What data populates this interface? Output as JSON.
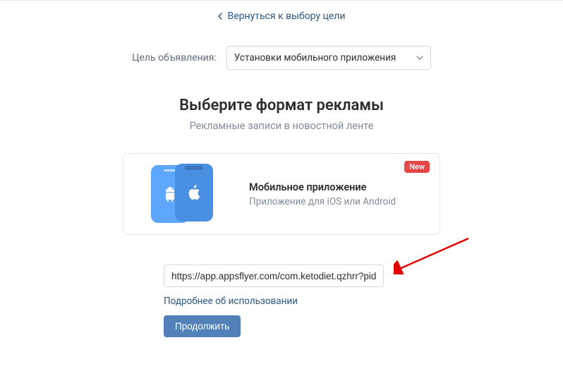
{
  "back_link": "Вернуться к выбору цели",
  "goal": {
    "label": "Цель объявления:",
    "select_value": "Установки мобильного приложения"
  },
  "heading": "Выберите формат рекламы",
  "subheading": "Рекламные записи в новостной ленте",
  "card": {
    "title": "Мобильное приложение",
    "desc": "Приложение для iOS или Android",
    "badge": "New"
  },
  "url_input_value": "https://app.appsflyer.com/com.ketodiet.qzhrr?pid=vk_",
  "more_link": "Подробнее об использовании",
  "continue_button": "Продолжить"
}
